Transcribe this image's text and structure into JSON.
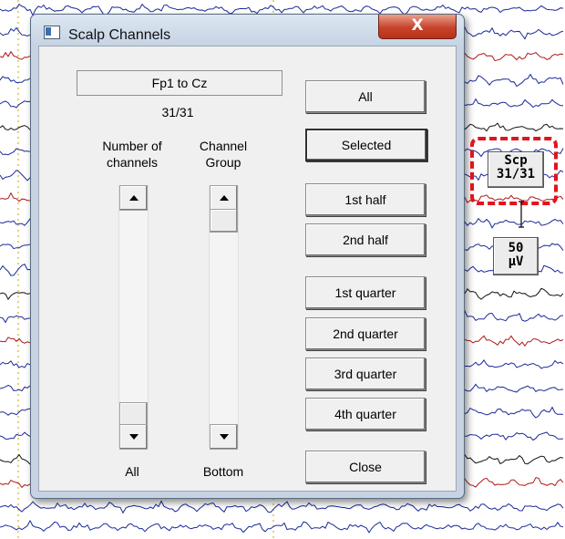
{
  "dialog": {
    "title": "Scalp Channels",
    "close_glyph": "X",
    "range_label": "Fp1  to  Cz",
    "count": "31/31",
    "number_of_channels_label": "Number of channels",
    "channel_group_label": "Channel Group",
    "left_scroll_caption": "All",
    "right_scroll_caption": "Bottom",
    "buttons": {
      "all": "All",
      "selected": "Selected",
      "first_half": "1st half",
      "second_half": "2nd half",
      "first_quarter": "1st quarter",
      "second_quarter": "2nd quarter",
      "third_quarter": "3rd quarter",
      "fourth_quarter": "4th quarter",
      "close": "Close"
    }
  },
  "side_controls": {
    "scp_line1": "Scp",
    "scp_line2": "31/31",
    "uv_line1": "50",
    "uv_line2": "µV"
  },
  "icons": {
    "app": "window-icon",
    "close": "close-icon",
    "up": "arrow-up-icon",
    "down": "arrow-down-icon",
    "cursor": "text-cursor-icon"
  },
  "colors": {
    "highlight": "#e0141e",
    "close_button": "#c7432a",
    "trace_blue": "#1a2a9a",
    "trace_red": "#b01818",
    "trace_black": "#111111"
  }
}
